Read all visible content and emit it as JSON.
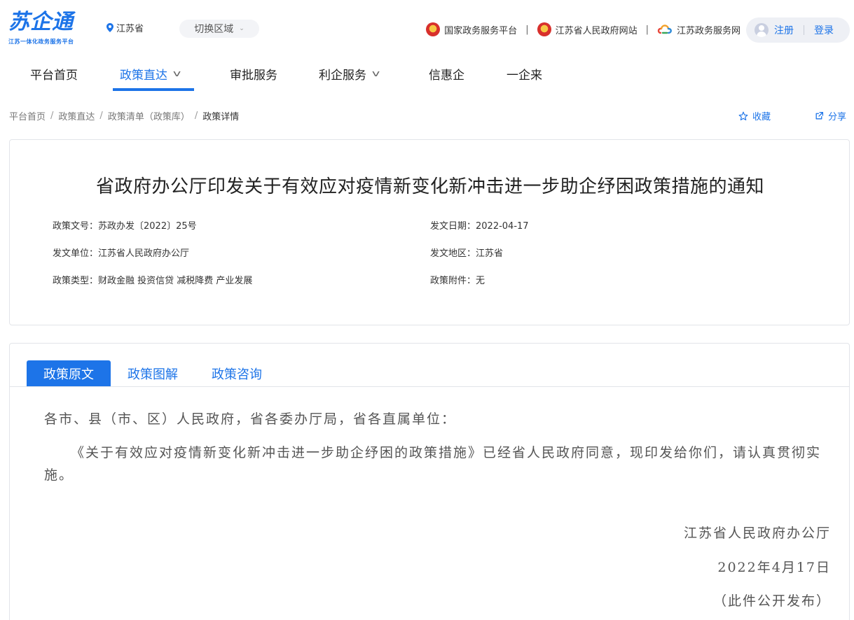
{
  "header": {
    "logo_text": "苏企通",
    "logo_subtitle": "江苏一体化政务服务平台",
    "region": "江苏省",
    "switch_region_label": "切换区域",
    "links": [
      {
        "label": "国家政务服务平台",
        "icon": "national-emblem-icon"
      },
      {
        "label": "江苏省人民政府网站",
        "icon": "national-emblem-icon"
      },
      {
        "label": "江苏政务服务网",
        "icon": "jiangsu-service-logo-icon"
      }
    ],
    "register_label": "注册",
    "login_label": "登录"
  },
  "nav": {
    "items": [
      {
        "label": "平台首页",
        "has_dropdown": false,
        "active": false
      },
      {
        "label": "政策直达",
        "has_dropdown": true,
        "active": true
      },
      {
        "label": "审批服务",
        "has_dropdown": false,
        "active": false
      },
      {
        "label": "利企服务",
        "has_dropdown": true,
        "active": false
      },
      {
        "label": "信惠企",
        "has_dropdown": false,
        "active": false
      },
      {
        "label": "一企来",
        "has_dropdown": false,
        "active": false
      }
    ]
  },
  "breadcrumb": {
    "items": [
      "平台首页",
      "政策直达",
      "政策清单（政策库）",
      "政策详情"
    ]
  },
  "actions": {
    "favorite_label": "收藏",
    "share_label": "分享"
  },
  "policy": {
    "title": "省政府办公厅印发关于有效应对疫情新变化新冲击进一步助企纾困政策措施的通知",
    "doc_number": "政策文号：苏政办发〔2022〕25号",
    "issue_date": "发文日期：2022-04-17",
    "issuer": "发文单位：江苏省人民政府办公厅",
    "region": "发文地区：江苏省",
    "type": "政策类型：财政金融 投资信贷 减税降费 产业发展",
    "attachment": "政策附件：无"
  },
  "tabs": [
    "政策原文",
    "政策图解",
    "政策咨询"
  ],
  "document": {
    "salutation": "各市、县（市、区）人民政府，省各委办厅局，省各直属单位：",
    "body": "《关于有效应对疫情新变化新冲击进一步助企纾困的政策措施》已经省人民政府同意，现印发给你们，请认真贯彻实施。",
    "signer": "江苏省人民政府办公厅",
    "date": "2022年4月17日",
    "note": "（此件公开发布）"
  },
  "colors": {
    "accent": "#1d74e8",
    "border": "#e2e4e9"
  }
}
